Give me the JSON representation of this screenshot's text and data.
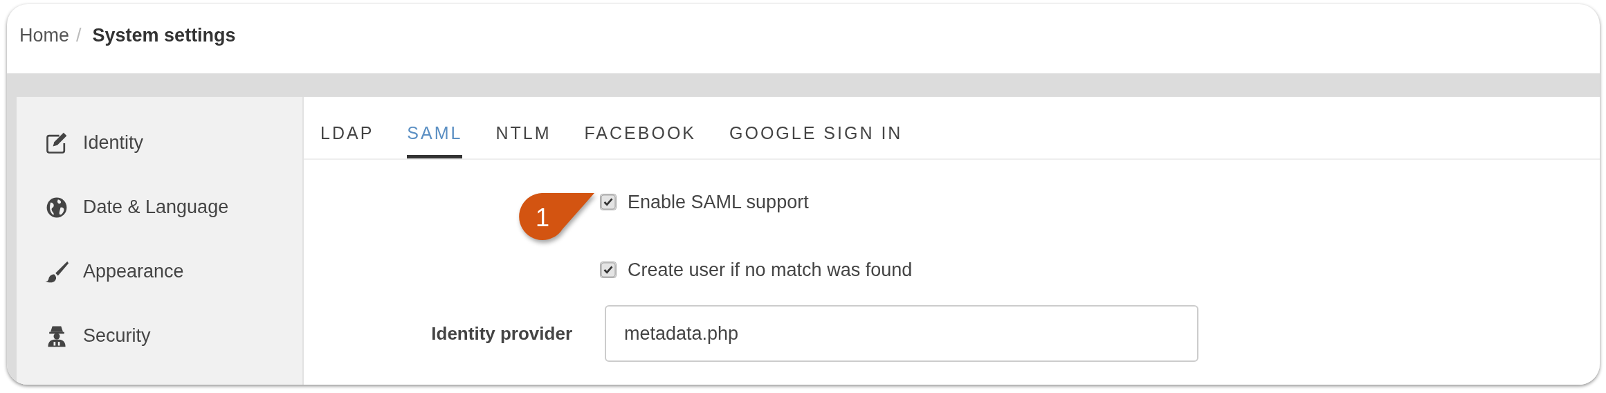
{
  "breadcrumb": {
    "home": "Home",
    "separator": "/",
    "current": "System settings"
  },
  "sidebar": {
    "items": [
      {
        "label": "Identity",
        "kind": "edit"
      },
      {
        "label": "Date & Language",
        "kind": "globe"
      },
      {
        "label": "Appearance",
        "kind": "brush"
      },
      {
        "label": "Security",
        "kind": "secret"
      }
    ]
  },
  "tabs": [
    {
      "label": "LDAP",
      "selected": false
    },
    {
      "label": "SAML",
      "selected": true
    },
    {
      "label": "NTLM",
      "selected": false
    },
    {
      "label": "FACEBOOK",
      "selected": false
    },
    {
      "label": "GOOGLE SIGN IN",
      "selected": false
    }
  ],
  "options": [
    {
      "label": "Enable SAML support",
      "checked": true
    },
    {
      "label": "Create user if no match was found",
      "checked": true
    }
  ],
  "fields": [
    {
      "label": "Identity provider",
      "value": "metadata.php"
    }
  ],
  "callout": {
    "label": "1"
  }
}
